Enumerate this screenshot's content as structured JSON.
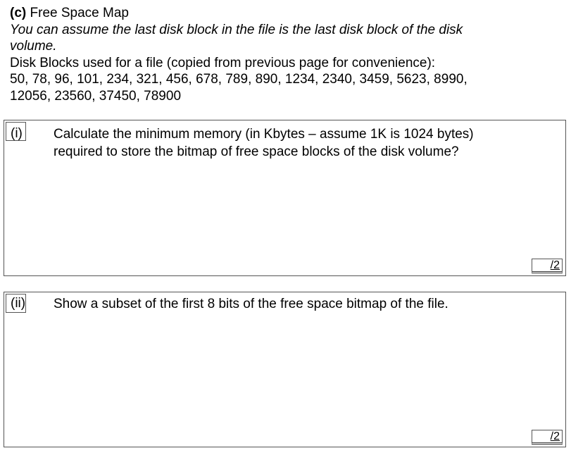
{
  "section": {
    "label": "(c)",
    "title": "Free Space Map",
    "assumption_line1": "You can assume the last disk block in the file is the last disk block of the disk",
    "assumption_line2": "volume.",
    "blocks_intro": "Disk Blocks used for a file (copied from previous page for convenience):",
    "blocks_line1": "50, 78, 96, 101, 234, 321, 456, 678, 789, 890, 1234, 2340, 3459, 5623, 8990,",
    "blocks_line2": "12056, 23560, 37450, 78900"
  },
  "questions": [
    {
      "number": "(i)",
      "text_line1": "Calculate the minimum memory (in Kbytes – assume 1K is 1024 bytes)",
      "text_line2": "required to store the bitmap of free space blocks of the disk volume?",
      "marks": "/2"
    },
    {
      "number": "(ii)",
      "text_line1": "Show a subset of the first 8 bits of the free space bitmap of the file.",
      "marks": "/2"
    }
  ]
}
